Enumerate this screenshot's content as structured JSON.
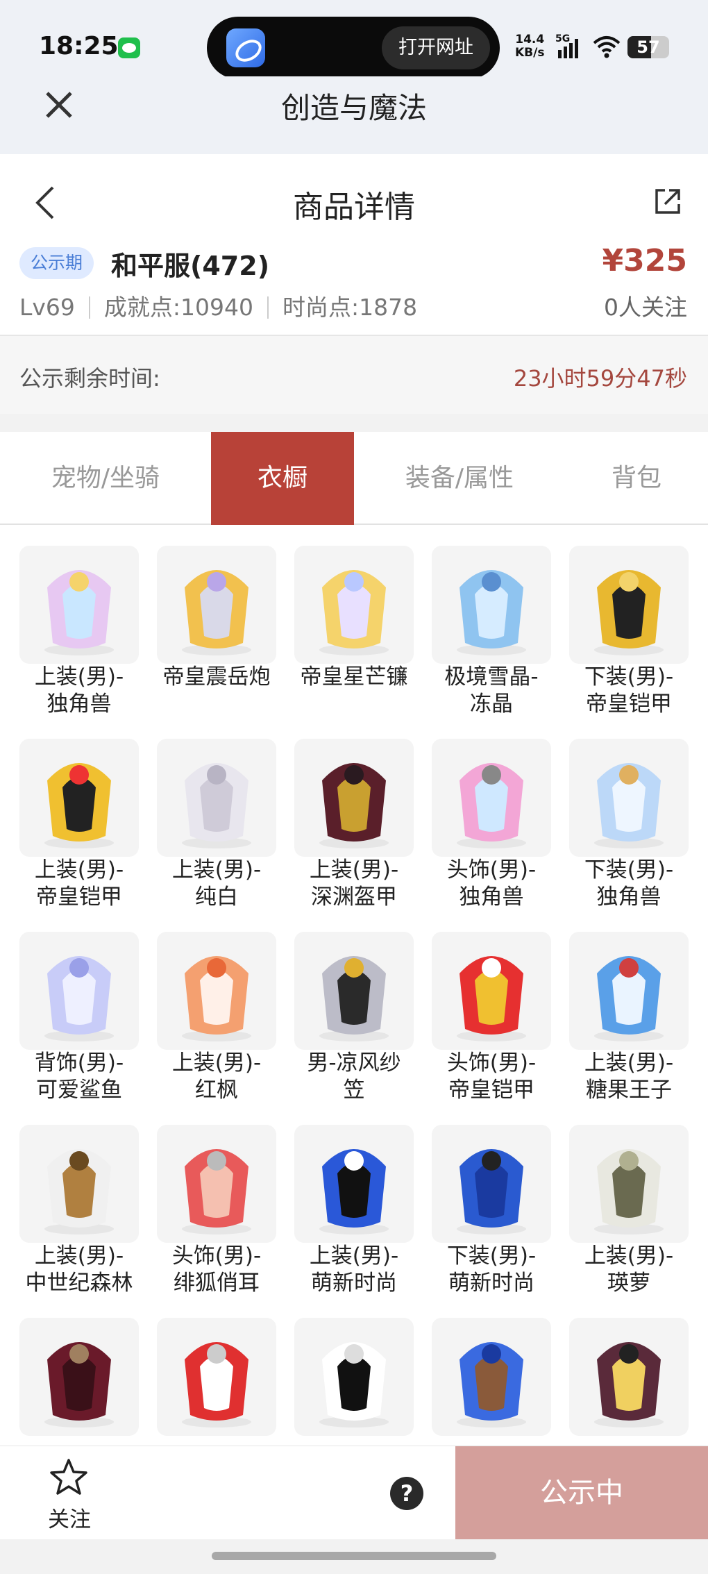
{
  "status_bar": {
    "time": "18:25",
    "pill_button": "打开网址",
    "net_speed_value": "14.4",
    "net_speed_unit": "KB/s",
    "network": "5G",
    "battery": "57"
  },
  "app_bar": {
    "title": "创造与魔法"
  },
  "page": {
    "title": "商品详情",
    "badge": "公示期",
    "server": "和平服(472)",
    "price": "¥325",
    "level": "Lv69",
    "achievement": "成就点:10940",
    "fashion": "时尚点:1878",
    "followers": "0人关注",
    "countdown_label": "公示剩余时间:",
    "countdown_value": "23小时59分47秒"
  },
  "tabs": [
    {
      "label": "宠物/坐骑",
      "active": false
    },
    {
      "label": "衣橱",
      "active": true
    },
    {
      "label": "装备/属性",
      "active": false
    },
    {
      "label": "背包",
      "active": false
    }
  ],
  "items": [
    {
      "line1": "上装(男)-",
      "line2": "独角兽",
      "icon": "unicorn-wings-icon"
    },
    {
      "line1": "帝皇震岳炮",
      "line2": "",
      "icon": "golden-cannon-icon"
    },
    {
      "line1": "帝皇星芒镰",
      "line2": "",
      "icon": "star-scythe-icon"
    },
    {
      "line1": "极境雪晶-",
      "line2": "冻晶",
      "icon": "ice-spear-icon"
    },
    {
      "line1": "下装(男)-",
      "line2": "帝皇铠甲",
      "icon": "golden-boots-icon"
    },
    {
      "line1": "上装(男)-",
      "line2": "帝皇铠甲",
      "icon": "golden-armor-icon"
    },
    {
      "line1": "上装(男)-",
      "line2": "纯白",
      "icon": "white-coat-icon"
    },
    {
      "line1": "上装(男)-",
      "line2": "深渊盔甲",
      "icon": "abyss-armor-icon"
    },
    {
      "line1": "头饰(男)-",
      "line2": "独角兽",
      "icon": "unicorn-hood-icon"
    },
    {
      "line1": "下装(男)-",
      "line2": "独角兽",
      "icon": "unicorn-shoes-icon"
    },
    {
      "line1": "背饰(男)-",
      "line2": "可爱鲨鱼",
      "icon": "shark-backpack-icon"
    },
    {
      "line1": "上装(男)-",
      "line2": "红枫",
      "icon": "maple-robe-icon"
    },
    {
      "line1": "男-凉风纱",
      "line2": "笠",
      "icon": "veil-hat-icon"
    },
    {
      "line1": "头饰(男)-",
      "line2": "帝皇铠甲",
      "icon": "golden-helmet-icon"
    },
    {
      "line1": "上装(男)-",
      "line2": "糖果王子",
      "icon": "candy-prince-coat-icon"
    },
    {
      "line1": "上装(男)-",
      "line2": "中世纪森林",
      "icon": "medieval-vest-icon"
    },
    {
      "line1": "头饰(男)-",
      "line2": "绯狐俏耳",
      "icon": "fox-ears-icon"
    },
    {
      "line1": "上装(男)-",
      "line2": "萌新时尚",
      "icon": "blue-jacket-icon"
    },
    {
      "line1": "下装(男)-",
      "line2": "萌新时尚",
      "icon": "blue-pants-icon"
    },
    {
      "line1": "上装(男)-",
      "line2": "瑛萝",
      "icon": "scarf-top-icon"
    },
    {
      "line1": "",
      "line2": "",
      "icon": "red-pants-icon"
    },
    {
      "line1": "",
      "line2": "",
      "icon": "red-hoodie-icon"
    },
    {
      "line1": "",
      "line2": "",
      "icon": "white-boots-icon"
    },
    {
      "line1": "",
      "line2": "",
      "icon": "octopus-hat-icon"
    },
    {
      "line1": "",
      "line2": "",
      "icon": "dark-helmet-icon"
    }
  ],
  "bottom_bar": {
    "follow_label": "关注",
    "help": "?",
    "status_button": "公示中"
  },
  "colors": {
    "accent": "#b84238",
    "price": "#b2453b",
    "badge_bg": "#dfeaff",
    "badge_text": "#4a7ed6",
    "status_button": "#d49f9b"
  }
}
